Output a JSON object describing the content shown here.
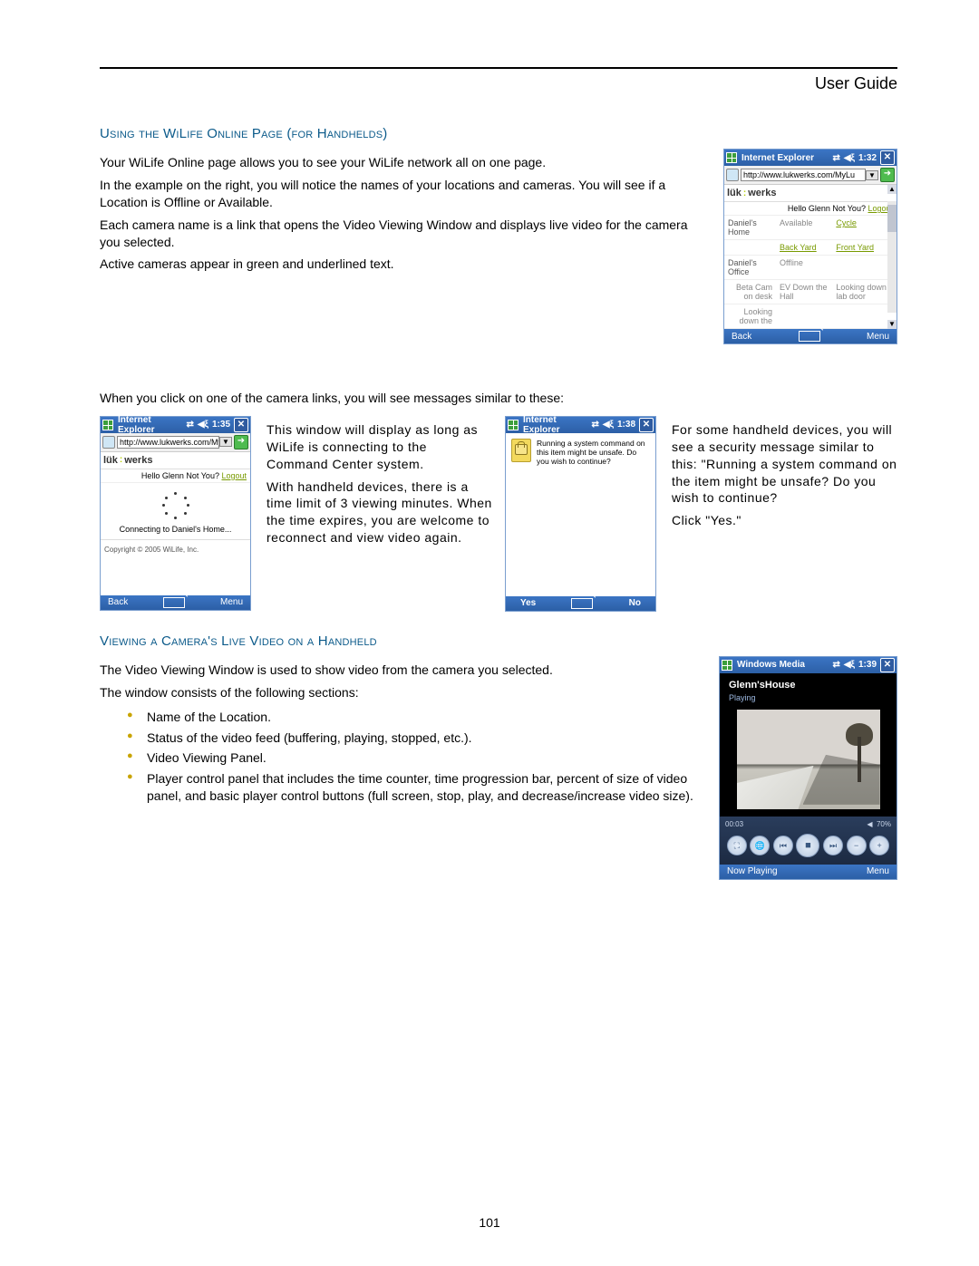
{
  "header": {
    "title": "User Guide"
  },
  "page_number": "101",
  "section1": {
    "heading": "Using the WiLife Online Page (for Handhelds)",
    "p1": "Your WiLife Online page allows you to see your WiLife network all on one page.",
    "p2": "In the example on the right, you will notice the names of your locations and cameras.  You will see if a Location is Offline or Available.",
    "p3": "Each camera name is a link that opens the Video Viewing Window and displays live video for the camera you selected.",
    "p4": "Active cameras appear in green and underlined text."
  },
  "screen1": {
    "titlebar_app": "Internet Explorer",
    "time": "1:32",
    "url": "http://www.lukwerks.com/MyLu",
    "logo_a": "lük",
    "logo_b": "werks",
    "greeting": "Hello Glenn Not You?",
    "logout": "Logout",
    "locations": [
      {
        "name": "Daniel's Home",
        "status": "Available",
        "status_link": "Cycle",
        "cameras": [
          {
            "label": "Back Yard",
            "active": true
          },
          {
            "label": "Front Yard",
            "active": true
          }
        ]
      },
      {
        "name": "Daniel's Office",
        "status": "Offline",
        "cameras": [
          {
            "label": "Beta Cam on desk",
            "active": false
          },
          {
            "label": "EV Down the Hall",
            "active": false
          },
          {
            "label": "Looking down lab door",
            "active": false
          },
          {
            "label": "Looking down the",
            "active": false
          }
        ]
      }
    ],
    "back": "Back",
    "menu": "Menu"
  },
  "bridge_text": "When you click on one of the camera links, you will see messages similar to these:",
  "screen2": {
    "titlebar_app": "Internet Explorer",
    "time": "1:35",
    "url": "http://www.lukwerks.com/MyLu",
    "logo_a": "lük",
    "logo_b": "werks",
    "greeting": "Hello Glenn Not You?",
    "logout": "Logout",
    "connecting": "Connecting to Daniel's Home...",
    "copyright": "Copyright © 2005 WiLife, Inc.",
    "back": "Back",
    "menu": "Menu"
  },
  "screen2_desc": {
    "p1": "This window will display as long as WiLife is connecting to the Command Center system.",
    "p2": "With handheld devices, there is a time limit of 3 viewing minutes. When the time expires, you are welcome to reconnect and view video again."
  },
  "screen3": {
    "titlebar_app": "Internet Explorer",
    "time": "1:38",
    "dialog": "Running a system command on this item might be unsafe. Do you wish to continue?",
    "yes": "Yes",
    "no": "No"
  },
  "screen3_desc": {
    "p1": "For some handheld devices, you will see a security message similar to this: \"Running a system command on the item might be unsafe? Do you wish to continue?",
    "p2": "Click \"Yes.\""
  },
  "section2": {
    "heading": "Viewing a Camera's Live Video on a Handheld",
    "p1": "The Video Viewing Window is used to show video from the camera you selected.",
    "p2": "The window consists of the following sections:",
    "bullets": [
      "Name of the Location.",
      "Status of the video feed (buffering, playing, stopped, etc.).",
      "Video Viewing Panel.",
      "Player control panel that includes the time counter, time progression bar, percent of size of video panel, and basic player control buttons (full screen, stop, play, and decrease/increase video size)."
    ]
  },
  "screen4": {
    "titlebar_app": "Windows Media",
    "time": "1:39",
    "location": "Glenn'sHouse",
    "status": "Playing",
    "elapsed": "00:03",
    "volume_icon": "◀",
    "size": "70%",
    "now_playing": "Now Playing",
    "menu": "Menu"
  }
}
